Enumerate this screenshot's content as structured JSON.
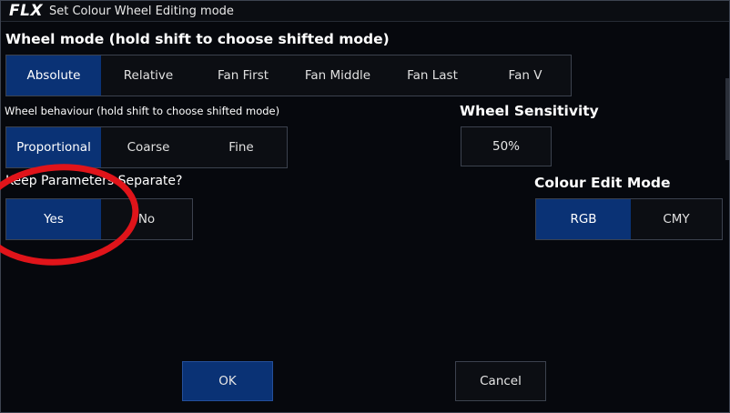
{
  "window": {
    "logo": "FLX",
    "title": "Set Colour Wheel Editing mode"
  },
  "wheel_mode": {
    "label": "Wheel mode (hold shift to choose shifted mode)",
    "options": [
      "Absolute",
      "Relative",
      "Fan First",
      "Fan Middle",
      "Fan Last",
      "Fan V"
    ],
    "selected": "Absolute"
  },
  "wheel_behaviour": {
    "label": "Wheel behaviour (hold shift to choose shifted mode)",
    "options": [
      "Proportional",
      "Coarse",
      "Fine"
    ],
    "selected": "Proportional"
  },
  "wheel_sensitivity": {
    "label": "Wheel Sensitivity",
    "value": "50%"
  },
  "keep_parameters": {
    "label": "Keep Parameters Separate?",
    "options": [
      "Yes",
      "No"
    ],
    "selected": "Yes"
  },
  "colour_edit_mode": {
    "label": "Colour Edit Mode",
    "options": [
      "RGB",
      "CMY"
    ],
    "selected": "RGB"
  },
  "actions": {
    "ok": "OK",
    "cancel": "Cancel"
  },
  "colors": {
    "selected": "#0a3275",
    "annotation": "#e0141a"
  }
}
